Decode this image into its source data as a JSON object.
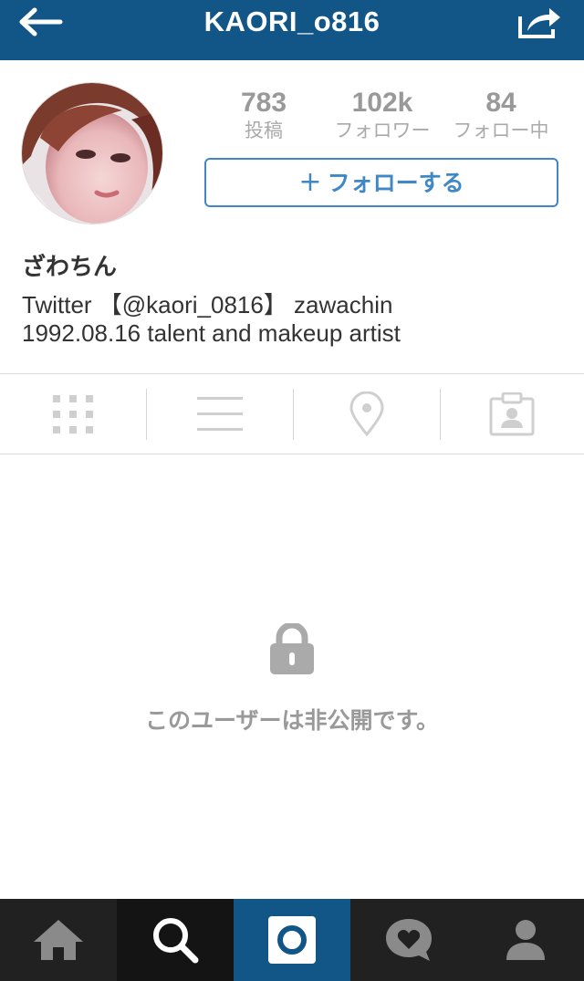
{
  "header": {
    "title": "KAORI_o816",
    "back_icon": "arrow-left-icon",
    "share_icon": "share-icon",
    "bg_color": "#125688"
  },
  "profile": {
    "avatar_alt": "profile photo",
    "stats": [
      {
        "value": "783",
        "label": "投稿"
      },
      {
        "value": "102k",
        "label": "フォロワー"
      },
      {
        "value": "84",
        "label": "フォロー中"
      }
    ],
    "follow_button": {
      "plus": "+",
      "label": "フォローする",
      "color": "#3f88c5"
    },
    "name": "ざわちん",
    "bio_lines": [
      "Twitter 【@kaori_0816】 zawachin",
      "1992.08.16 talent and makeup artist"
    ]
  },
  "tabs": [
    {
      "icon": "grid-icon"
    },
    {
      "icon": "list-icon"
    },
    {
      "icon": "location-pin-icon"
    },
    {
      "icon": "tagged-photos-icon"
    }
  ],
  "private": {
    "icon": "lock-icon",
    "message": "このユーザーは非公開です。"
  },
  "bottom_nav": [
    {
      "icon": "home-icon",
      "active": false
    },
    {
      "icon": "search-icon",
      "active": true
    },
    {
      "icon": "camera-icon",
      "active": false
    },
    {
      "icon": "activity-heart-icon",
      "active": false
    },
    {
      "icon": "profile-icon",
      "active": false
    }
  ]
}
